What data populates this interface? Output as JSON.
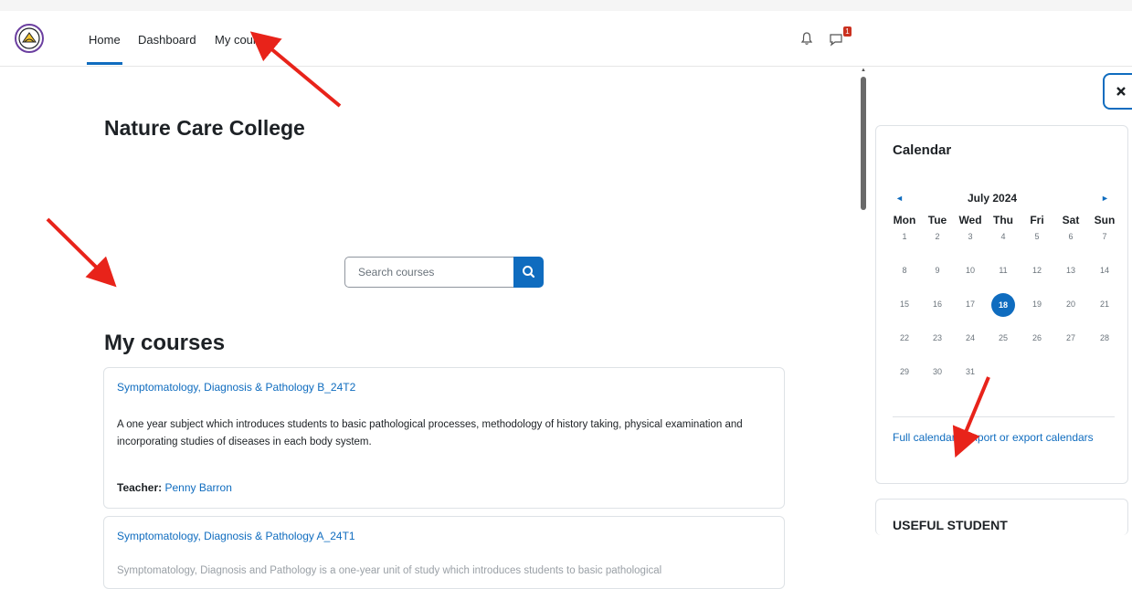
{
  "nav": {
    "items": [
      {
        "label": "Home",
        "active": true
      },
      {
        "label": "Dashboard",
        "active": false
      },
      {
        "label": "My courses",
        "active": false
      }
    ],
    "message_badge": "1"
  },
  "site": {
    "title": "Nature Care College"
  },
  "search": {
    "placeholder": "Search courses"
  },
  "my_courses": {
    "title": "My courses",
    "courses": [
      {
        "name": "Symptomatology, Diagnosis & Pathology B_24T2",
        "description": "A one year subject which introduces students to basic pathological processes, methodology of history taking, physical examination and incorporating studies of diseases in each body system.",
        "teacher_label": "Teacher:",
        "teacher_name": "Penny Barron"
      },
      {
        "name": "Symptomatology, Diagnosis & Pathology A_24T1",
        "description": "Symptomatology, Diagnosis and Pathology is a one-year unit of study which introduces students to basic pathological"
      }
    ]
  },
  "calendar": {
    "title": "Calendar",
    "prev_label": "◄",
    "next_label": "►",
    "month": "July 2024",
    "weekdays": [
      "Mon",
      "Tue",
      "Wed",
      "Thu",
      "Fri",
      "Sat",
      "Sun"
    ],
    "weeks": [
      [
        "1",
        "2",
        "3",
        "4",
        "5",
        "6",
        "7"
      ],
      [
        "8",
        "9",
        "10",
        "11",
        "12",
        "13",
        "14"
      ],
      [
        "15",
        "16",
        "17",
        "18",
        "19",
        "20",
        "21"
      ],
      [
        "22",
        "23",
        "24",
        "25",
        "26",
        "27",
        "28"
      ],
      [
        "29",
        "30",
        "31",
        "",
        "",
        "",
        ""
      ]
    ],
    "today": "18",
    "full_calendar_label": "Full calendar",
    "separator": "•",
    "import_export_label": "Import or export calendars"
  },
  "useful": {
    "title": "USEFUL STUDENT"
  },
  "colors": {
    "accent": "#0f6cbf",
    "annotation_arrow": "#e8231a",
    "badge": "#ca3120"
  }
}
